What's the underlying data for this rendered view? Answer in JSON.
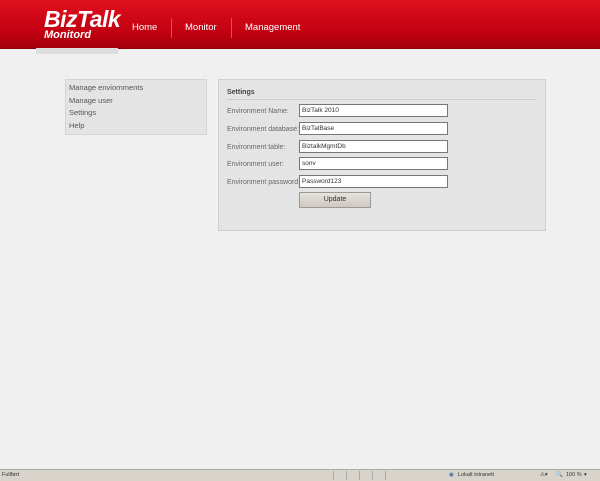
{
  "header": {
    "logo_main": "BizTalk",
    "logo_sub": "Monitord",
    "nav": [
      "Home",
      "Monitor",
      "Management"
    ]
  },
  "sidebar": {
    "items": [
      "Manage enviornments",
      "Manage user",
      "Settings",
      "Help"
    ]
  },
  "settings": {
    "title": "Settings",
    "fields": [
      {
        "label": "Environment Name:",
        "value": "BizTalk 2010"
      },
      {
        "label": "Environment database:",
        "value": "BizTalBase"
      },
      {
        "label": "Environment table:",
        "value": "BiztalkMgmtDb"
      },
      {
        "label": "Environment user:",
        "value": "sonv"
      },
      {
        "label": "Environment password:",
        "value": "Password123"
      }
    ],
    "update_label": "Update"
  },
  "statusbar": {
    "status": "Fullført",
    "zone": "Lokalt intranett",
    "zoom": "100 %"
  }
}
